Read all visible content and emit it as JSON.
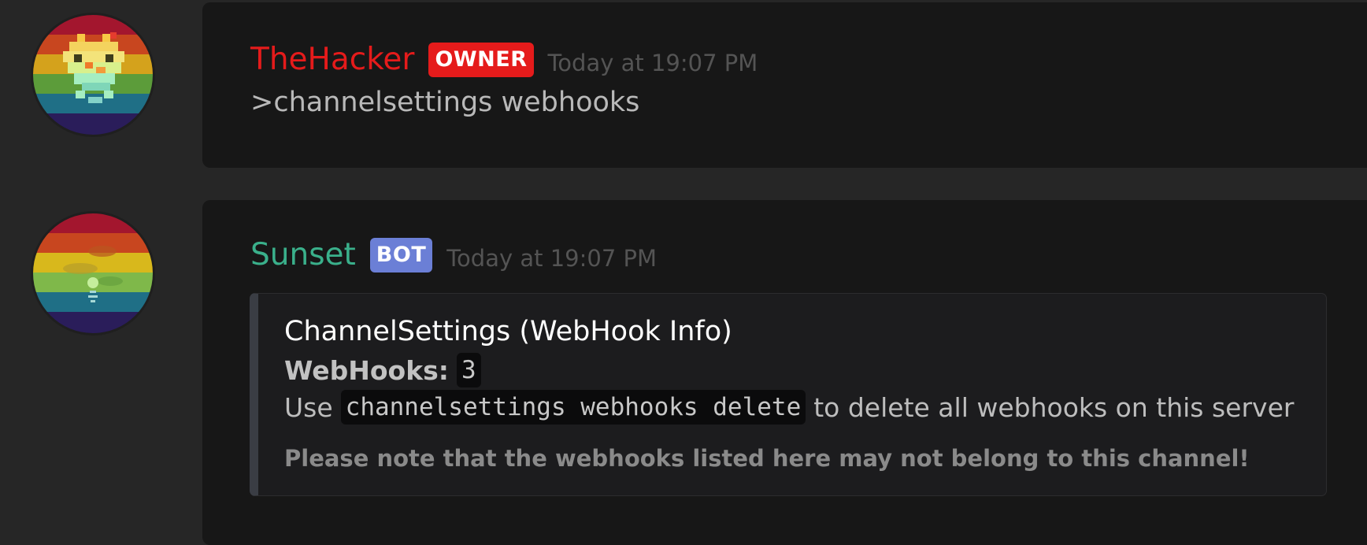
{
  "colors": {
    "background": "#262626",
    "message_panel": "#171717",
    "owner_name": "#e51b1b",
    "owner_badge": "#e51b1b",
    "bot_name": "#3ab08b",
    "bot_badge": "#6b7fd6",
    "timestamp": "#545454",
    "embed_border": "#3a3d44"
  },
  "messages": [
    {
      "avatar_icon": "pixel-invader-rainbow-avatar-icon",
      "username": "TheHacker",
      "badge": "OWNER",
      "timestamp": "Today at 19:07 PM",
      "content": ">channelsettings webhooks"
    },
    {
      "avatar_icon": "sunset-rainbow-avatar-icon",
      "username": "Sunset",
      "badge": "BOT",
      "timestamp": "Today at 19:07 PM",
      "embed": {
        "title": "ChannelSettings (WebHook Info)",
        "webhooks_label": "WebHooks:",
        "webhooks_count": "3",
        "use_prefix": "Use",
        "command": "channelsettings webhooks delete",
        "use_suffix": "to delete all webhooks on this server",
        "footer": "Please note that the webhooks listed here may not belong to this channel!"
      }
    }
  ]
}
